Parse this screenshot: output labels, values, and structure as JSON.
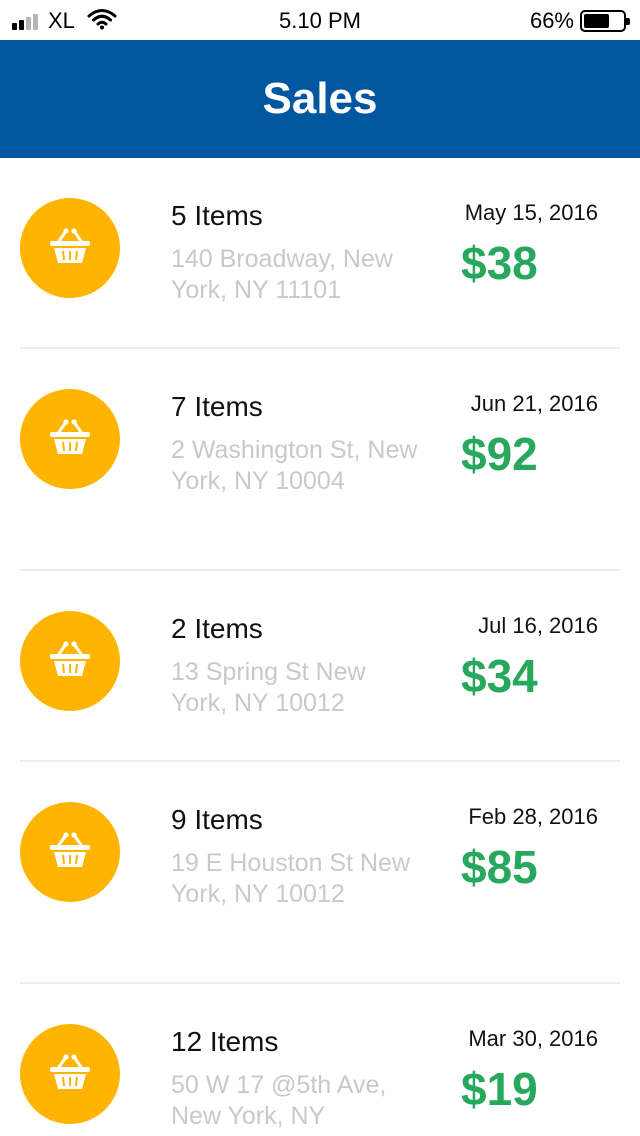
{
  "status_bar": {
    "carrier": "XL",
    "time": "5.10 PM",
    "battery_percent_text": "66%",
    "battery_level": 0.66,
    "signal_bars_filled": 2,
    "signal_bars_total": 4,
    "icons": [
      "signal-icon",
      "wifi-icon",
      "battery-icon"
    ]
  },
  "header": {
    "title": "Sales",
    "background_color": "#0057a0"
  },
  "colors": {
    "accent_icon_bg": "#ffb400",
    "amount_green": "#28a85c",
    "address_gray": "#c9c9c9"
  },
  "sales": [
    {
      "items": "5 Items",
      "address": "140 Broadway, New York, NY 11101",
      "date": "May 15, 2016",
      "amount": "$38",
      "icon": "basket-icon"
    },
    {
      "items": "7 Items",
      "address": "2 Washington St, New York, NY 10004",
      "date": "Jun 21, 2016",
      "amount": "$92",
      "icon": "basket-icon"
    },
    {
      "items": "2 Items",
      "address": "13 Spring St New York, NY 10012",
      "date": "Jul 16, 2016",
      "amount": "$34",
      "icon": "basket-icon"
    },
    {
      "items": "9 Items",
      "address": "19 E Houston St New York, NY 10012",
      "date": "Feb 28, 2016",
      "amount": "$85",
      "icon": "basket-icon"
    },
    {
      "items": "12 Items",
      "address": "50 W 17 @5th Ave, New York, NY",
      "date": "Mar 30, 2016",
      "amount": "$19",
      "icon": "basket-icon"
    }
  ]
}
